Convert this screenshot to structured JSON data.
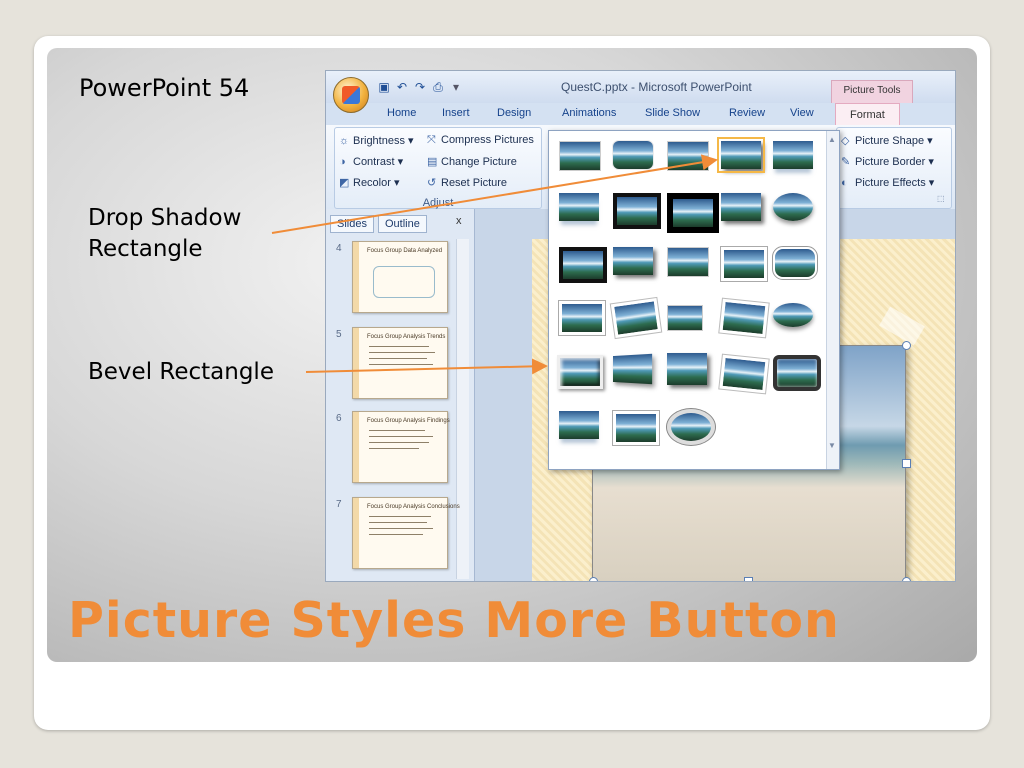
{
  "slide": {
    "number_label": "PowerPoint 54",
    "title": "Picture Styles More Button",
    "callouts": [
      {
        "line1": "Drop Shadow",
        "line2": "Rectangle"
      },
      {
        "line1": "Bevel Rectangle"
      }
    ]
  },
  "app": {
    "title": "QuestC.pptx - Microsoft PowerPoint",
    "context_tab": "Picture Tools",
    "tabs": [
      "Home",
      "Insert",
      "Design",
      "Animations",
      "Slide Show",
      "Review",
      "View",
      "Format"
    ],
    "active_tab": "Format"
  },
  "ribbon": {
    "adjust": {
      "label": "Adjust",
      "brightness": "Brightness",
      "contrast": "Contrast",
      "recolor": "Recolor",
      "compress": "Compress Pictures",
      "change": "Change Picture",
      "reset": "Reset Picture"
    },
    "picture": {
      "shape": "Picture Shape",
      "border": "Picture Border",
      "effects": "Picture Effects"
    }
  },
  "pane": {
    "tab_slides": "Slides",
    "tab_outline": "Outline",
    "close": "x",
    "thumbs": [
      {
        "num": "4",
        "title": "Focus Group Data Analyzed"
      },
      {
        "num": "5",
        "title": "Focus Group Analysis Trends"
      },
      {
        "num": "6",
        "title": "Focus Group Analysis Findings"
      },
      {
        "num": "7",
        "title": "Focus Group Analysis Conclusions"
      }
    ]
  },
  "colors": {
    "accent_orange": "#f08c38",
    "arrow": "#f08c38"
  },
  "icons": {
    "office_button": "office-logo-icon",
    "save": "save-icon",
    "undo": "undo-icon",
    "redo": "redo-icon",
    "print_preview": "print-preview-icon"
  }
}
